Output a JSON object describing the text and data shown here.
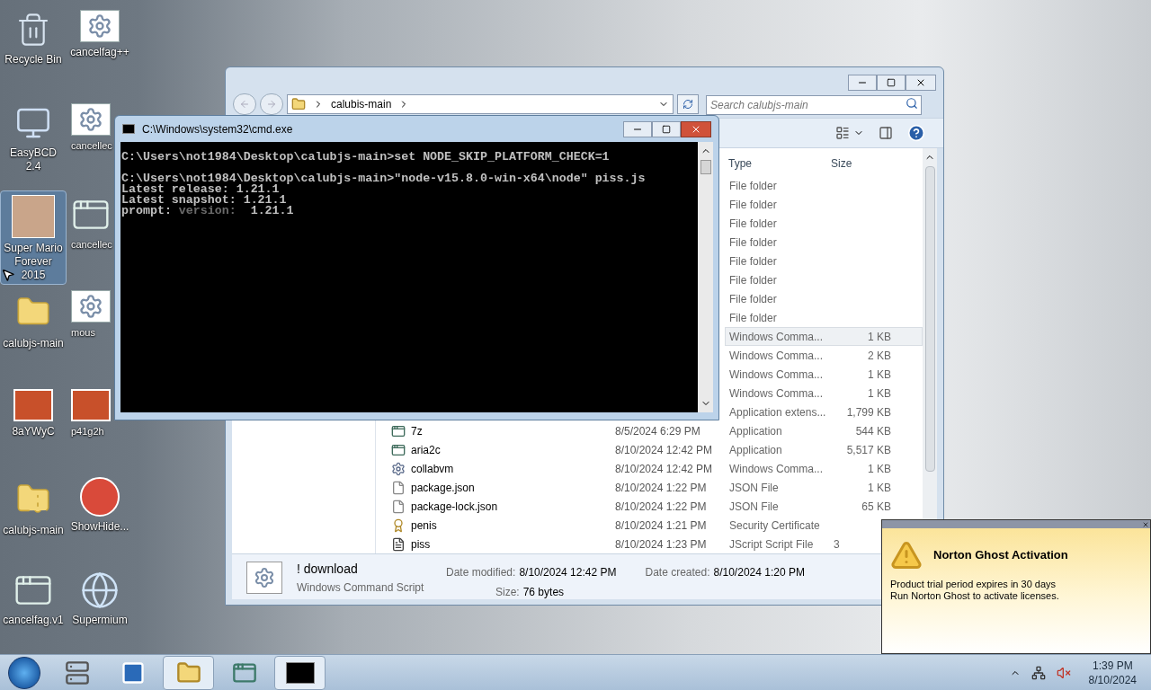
{
  "desktop_columns": [
    {
      "icons": [
        {
          "label": "Recycle Bin",
          "kind": "recycle-bin",
          "selected": false
        },
        {
          "label": "EasyBCD 2.4",
          "kind": "monitor-app",
          "selected": false
        },
        {
          "label": "Super Mario Forever 2015",
          "kind": "game",
          "selected": true
        },
        {
          "label": "calubjs-main",
          "kind": "folder",
          "selected": false
        },
        {
          "label": "8aYWyC",
          "kind": "image",
          "selected": false
        },
        {
          "label": "calubjs-main",
          "kind": "zip-folder",
          "selected": false
        },
        {
          "label": "cancelfag.v1",
          "kind": "app-window",
          "selected": false
        }
      ]
    },
    {
      "icons": [
        {
          "label": "cancelfag++",
          "kind": "script",
          "selected": false
        },
        {
          "label": "cancellec",
          "kind": "script",
          "selected": false
        },
        {
          "label": "cancellec",
          "kind": "app-window",
          "selected": false
        },
        {
          "label": "mous",
          "kind": "script",
          "selected": false
        },
        {
          "label": "p41g2h",
          "kind": "image",
          "selected": false
        },
        {
          "label": "ShowHide...",
          "kind": "badge-app",
          "selected": false
        },
        {
          "label": "Supermium",
          "kind": "browser",
          "selected": false
        }
      ]
    }
  ],
  "explorer": {
    "breadcrumb": "calubis-main",
    "search": {
      "placeholder": "Search calubjs-main"
    },
    "columns": {
      "type": "Type",
      "size": "Size"
    },
    "rows": [
      {
        "type": "File folder",
        "selected": false
      },
      {
        "type": "File folder",
        "selected": false
      },
      {
        "type": "File folder",
        "selected": false
      },
      {
        "type": "File folder",
        "selected": false
      },
      {
        "type": "File folder",
        "selected": false
      },
      {
        "type": "File folder",
        "selected": false
      },
      {
        "type": "File folder",
        "selected": false
      },
      {
        "type": "File folder",
        "selected": false
      },
      {
        "type": "Windows Comma...",
        "size": "1 KB",
        "selected": true
      },
      {
        "type": "Windows Comma...",
        "size": "2 KB",
        "selected": false
      },
      {
        "type": "Windows Comma...",
        "size": "1 KB",
        "selected": false
      },
      {
        "type": "Windows Comma...",
        "size": "1 KB",
        "selected": false
      },
      {
        "type": "Application extens...",
        "size": "1,799 KB",
        "selected": false
      },
      {
        "name": "7z",
        "kind": "app",
        "date": "8/5/2024 6:29 PM",
        "type": "Application",
        "size": "544 KB",
        "selected": false
      },
      {
        "name": "aria2c",
        "kind": "app",
        "date": "8/10/2024 12:42 PM",
        "type": "Application",
        "size": "5,517 KB",
        "selected": false
      },
      {
        "name": "collabvm",
        "kind": "script",
        "date": "8/10/2024 12:42 PM",
        "type": "Windows Comma...",
        "size": "1 KB",
        "selected": false
      },
      {
        "name": "package.json",
        "kind": "file",
        "date": "8/10/2024 1:22 PM",
        "type": "JSON File",
        "size": "1 KB",
        "selected": false
      },
      {
        "name": "package-lock.json",
        "kind": "file",
        "date": "8/10/2024 1:22 PM",
        "type": "JSON File",
        "size": "65 KB",
        "selected": false
      },
      {
        "name": "penis",
        "kind": "certificate",
        "date": "8/10/2024 1:21 PM",
        "type": "Security Certificate",
        "selected": false
      },
      {
        "name": "piss",
        "kind": "jscript",
        "date": "8/10/2024 1:23 PM",
        "type": "JScript Script File",
        "size": "3",
        "size_cut": true,
        "selected": false
      }
    ],
    "details": {
      "name": "! download",
      "type": "Windows Command Script",
      "modified_label": "Date modified:",
      "modified": "8/10/2024 12:42 PM",
      "created_label": "Date created:",
      "created": "8/10/2024 1:20 PM",
      "size_label": "Size:",
      "size": "76 bytes"
    }
  },
  "cmd": {
    "title": "C:\\Windows\\system32\\cmd.exe",
    "lines": [
      {
        "segments": [
          {
            "text": "C:\\Users\\not1984\\Desktop\\calubjs-main>set NODE_SKIP_PLATFORM_CHECK=1",
            "kind": "normal"
          }
        ]
      },
      {
        "gap_before": true,
        "segments": [
          {
            "text": "C:\\Users\\not1984\\Desktop\\calubjs-main>\"node-v15.8.0-win-x64\\node\" piss.js",
            "kind": "normal"
          }
        ]
      },
      {
        "segments": [
          {
            "text": "Latest release: 1.21.1",
            "kind": "normal"
          }
        ]
      },
      {
        "segments": [
          {
            "text": "Latest snapshot: 1.21.1",
            "kind": "normal"
          }
        ]
      },
      {
        "segments": [
          {
            "text": "prompt: ",
            "kind": "normal"
          },
          {
            "text": "version:",
            "kind": "dim"
          },
          {
            "text": "  1.21.1",
            "kind": "normal"
          }
        ]
      }
    ]
  },
  "notification": {
    "title": "Norton Ghost Activation",
    "lines": [
      "Product trial period expires in 30 days",
      "Run Norton Ghost to activate licenses."
    ]
  },
  "taskbar": {
    "items": [
      {
        "kind": "server",
        "active": false
      },
      {
        "kind": "powershell",
        "active": false
      },
      {
        "kind": "explorer",
        "active": true
      },
      {
        "kind": "app-window",
        "active": false
      },
      {
        "kind": "console",
        "active": true
      }
    ],
    "time": "1:39 PM",
    "date": "8/10/2024"
  }
}
